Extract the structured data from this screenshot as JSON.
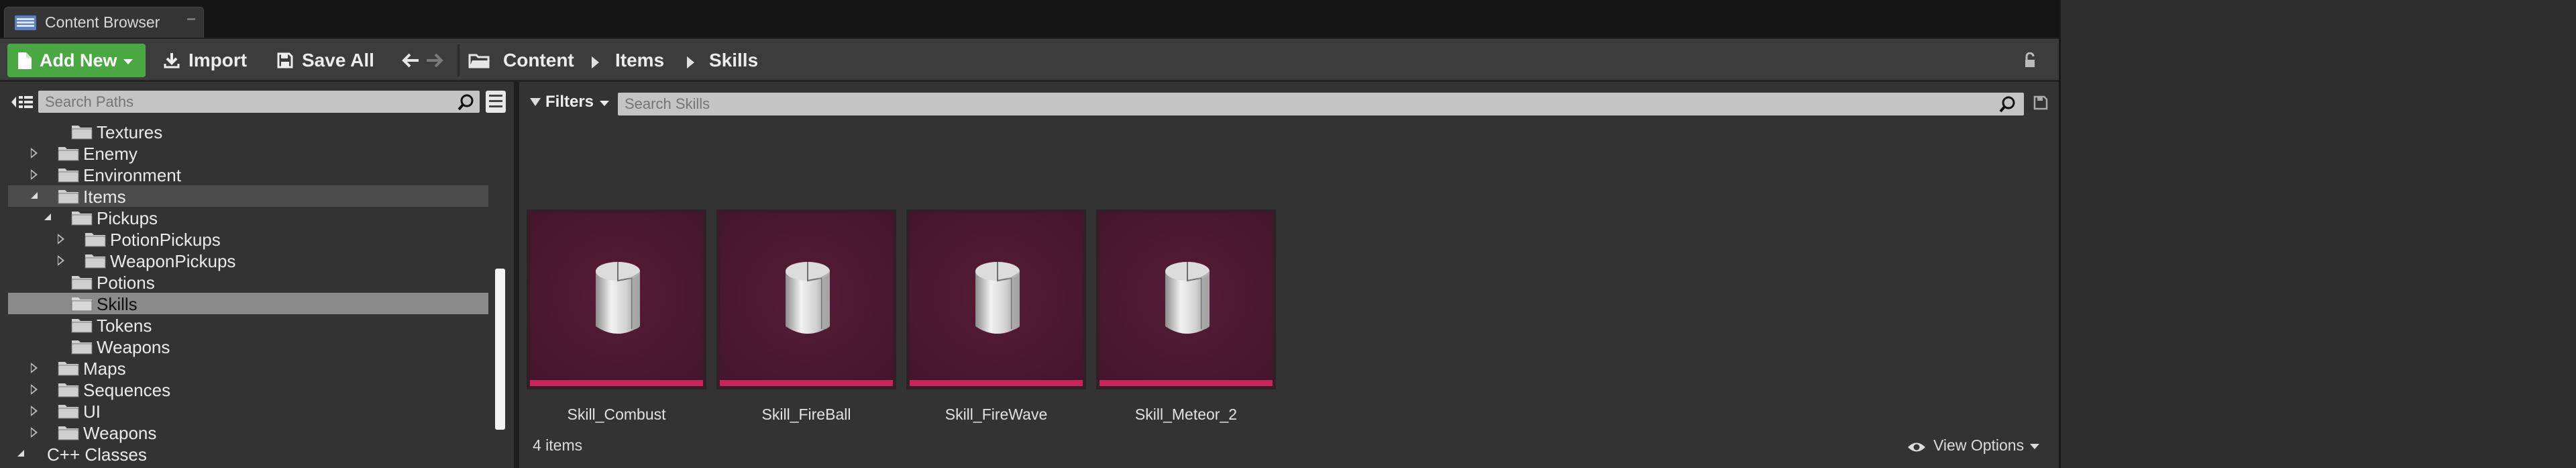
{
  "tab": {
    "title": "Content Browser"
  },
  "toolbar": {
    "add_new": "Add New",
    "import": "Import",
    "save_all": "Save All"
  },
  "breadcrumb": [
    "Content",
    "Items",
    "Skills"
  ],
  "sources": {
    "search_placeholder": "Search Paths",
    "tree": [
      {
        "label": "Textures",
        "depth": 1,
        "expander": "none",
        "state": "normal"
      },
      {
        "label": "Enemy",
        "depth": 0,
        "expander": "closed",
        "state": "normal"
      },
      {
        "label": "Environment",
        "depth": 0,
        "expander": "closed",
        "state": "normal"
      },
      {
        "label": "Items",
        "depth": 0,
        "expander": "open",
        "state": "highlighted"
      },
      {
        "label": "Pickups",
        "depth": 1,
        "expander": "open",
        "state": "normal"
      },
      {
        "label": "PotionPickups",
        "depth": 2,
        "expander": "closed",
        "state": "normal"
      },
      {
        "label": "WeaponPickups",
        "depth": 2,
        "expander": "closed",
        "state": "normal"
      },
      {
        "label": "Potions",
        "depth": 1,
        "expander": "none",
        "state": "normal"
      },
      {
        "label": "Skills",
        "depth": 1,
        "expander": "none",
        "state": "selected"
      },
      {
        "label": "Tokens",
        "depth": 1,
        "expander": "none",
        "state": "normal"
      },
      {
        "label": "Weapons",
        "depth": 1,
        "expander": "none",
        "state": "normal"
      },
      {
        "label": "Maps",
        "depth": 0,
        "expander": "closed",
        "state": "normal"
      },
      {
        "label": "Sequences",
        "depth": 0,
        "expander": "closed",
        "state": "normal"
      },
      {
        "label": "UI",
        "depth": 0,
        "expander": "closed",
        "state": "normal"
      },
      {
        "label": "Weapons",
        "depth": 0,
        "expander": "closed",
        "state": "normal"
      },
      {
        "label": "C++ Classes",
        "depth": -1,
        "expander": "open",
        "state": "normal"
      }
    ]
  },
  "assets": {
    "filters_label": "Filters",
    "search_placeholder": "Search Skills",
    "items": [
      {
        "name": "Skill_Combust"
      },
      {
        "name": "Skill_FireBall"
      },
      {
        "name": "Skill_FireWave"
      },
      {
        "name": "Skill_Meteor_2"
      }
    ],
    "count_text": "4 items",
    "view_options": "View Options"
  },
  "colors": {
    "add_new_bg": "#4aa843",
    "thumb_bg": "#561c36",
    "thumb_bar": "#c8265b",
    "selected_row": "#8a8a8a"
  }
}
